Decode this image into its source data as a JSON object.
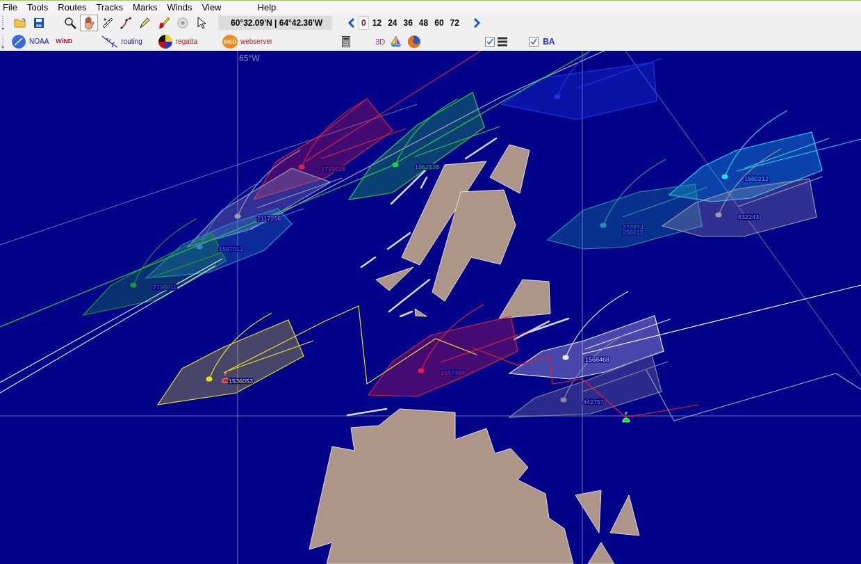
{
  "menu": [
    "File",
    "Tools",
    "Routes",
    "Tracks",
    "Marks",
    "Winds",
    "View",
    "Help"
  ],
  "toolbar": {
    "tools": [
      {
        "kind": "open",
        "selected": false
      },
      {
        "kind": "save",
        "selected": false
      },
      {
        "kind": "zoom",
        "selected": false
      },
      {
        "kind": "hand",
        "selected": true
      },
      {
        "kind": "ruler",
        "selected": false
      },
      {
        "kind": "route",
        "selected": false
      },
      {
        "kind": "pencil",
        "selected": false
      },
      {
        "kind": "paint",
        "selected": false
      },
      {
        "kind": "target",
        "selected": false
      },
      {
        "kind": "pointer",
        "selected": false
      }
    ],
    "coordinates": "60°32.09'N | 64°42.36'W",
    "hours": [
      {
        "label": "0",
        "selected": true
      },
      {
        "label": "12",
        "selected": false
      },
      {
        "label": "24",
        "selected": false
      },
      {
        "label": "36",
        "selected": false
      },
      {
        "label": "48",
        "selected": false
      },
      {
        "label": "60",
        "selected": false
      },
      {
        "label": "72",
        "selected": false
      }
    ]
  },
  "toolbar2": {
    "noaa": "NOAA",
    "wind_logo": "WiND",
    "routing": "routing",
    "regatta": "regatta",
    "web_logo": "web",
    "webserver": "webserver",
    "three_d": "3D",
    "checks": [
      {
        "kind": "layers",
        "checked": true
      },
      {
        "kind": "text",
        "checked": true,
        "label": "BA"
      }
    ]
  },
  "map": {
    "meridian_label": "65°W",
    "boats": [
      {
        "color": "#1a3ae8"
      },
      {
        "color": "#d82040",
        "labels": [
          "1719628"
        ]
      },
      {
        "color": "#22d044",
        "labels": [
          "1962538"
        ]
      },
      {
        "color": "#9a9ab8",
        "labels": [
          "2117258"
        ]
      },
      {
        "color": "#2a8cc8",
        "labels": [
          "1597012"
        ]
      },
      {
        "color": "#1a9a3a",
        "labels": [
          "2196811"
        ]
      },
      {
        "color": "#22d8f8",
        "labels": [
          "1660212"
        ]
      },
      {
        "color": "#1a9a9a",
        "labels": [
          "222874",
          "256815"
        ]
      },
      {
        "color": "#9a9aa8",
        "labels": [
          "632243"
        ]
      },
      {
        "color": "#e8e020",
        "labels": [
          "1536053"
        ]
      },
      {
        "color": "#e02040",
        "labels": [
          "1657498"
        ]
      },
      {
        "color": "#e8e8ff",
        "labels": [
          "1568468"
        ]
      },
      {
        "color": "#8a8a9a",
        "labels": [
          "442757"
        ]
      }
    ]
  }
}
